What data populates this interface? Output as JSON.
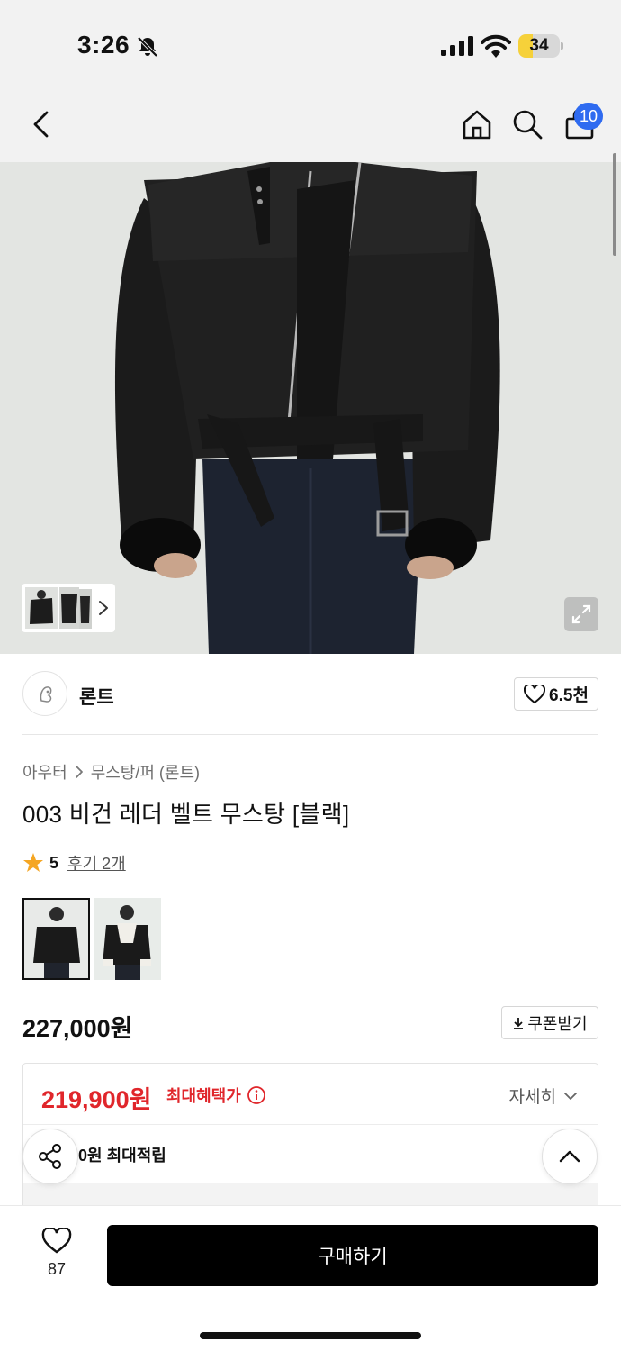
{
  "status_bar": {
    "time": "3:26",
    "battery_level": "34",
    "battery_fraction": 0.34,
    "icons": [
      "bell-off-icon",
      "signal-icon",
      "wifi-icon",
      "battery-icon"
    ]
  },
  "nav": {
    "cart_count": "10",
    "icons": [
      "chevron-left-icon",
      "home-icon",
      "search-icon",
      "shopping-bag-icon"
    ]
  },
  "brand": {
    "name": "론트",
    "likes": "6.5천"
  },
  "product": {
    "category": "아우터",
    "subcategory": "무스탕/퍼 (론트)",
    "title": "003 비건 레더 벨트 무스탕 [블랙]",
    "rating": "5",
    "reviews": "후기 2개",
    "price": "227,000원"
  },
  "coupon": {
    "label": "쿠폰받기"
  },
  "benefit": {
    "price": "219,900원",
    "label": "최대혜택가",
    "detail": "자세히",
    "points": "0원 최대적립"
  },
  "bottom_bar": {
    "wish_count": "87",
    "buy_label": "구매하기"
  },
  "colors": {
    "accent_blue": "#2f6bf0",
    "price_red": "#e0262b",
    "star": "#f5a623",
    "buy_button": "#000000"
  }
}
